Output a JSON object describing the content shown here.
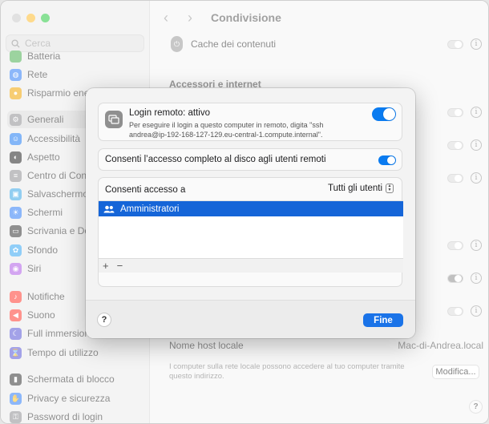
{
  "window": {
    "title": "Condivisione"
  },
  "sidebar": {
    "search_placeholder": "Cerca",
    "items": [
      {
        "label": "Batteria",
        "color": "#4caf50"
      },
      {
        "label": "Rete",
        "color": "#2f7df6"
      },
      {
        "label": "Risparmio energia",
        "color": "#f0a400"
      },
      {
        "label": "Generali",
        "color": "#8e8e93"
      },
      {
        "label": "Accessibilità",
        "color": "#1e7bf2"
      },
      {
        "label": "Aspetto",
        "color": "#222222"
      },
      {
        "label": "Centro di Controllo",
        "color": "#8e8e93"
      },
      {
        "label": "Salvaschermo",
        "color": "#3aa7e6"
      },
      {
        "label": "Schermi",
        "color": "#2f7df6"
      },
      {
        "label": "Scrivania e Dock",
        "color": "#333333"
      },
      {
        "label": "Sfondo",
        "color": "#35a7f2"
      },
      {
        "label": "Siri",
        "color": "#b05be6"
      },
      {
        "label": "Notifiche",
        "color": "#ff3b30"
      },
      {
        "label": "Suono",
        "color": "#ff3b30"
      },
      {
        "label": "Full immersion",
        "color": "#5856d6"
      },
      {
        "label": "Tempo di utilizzo",
        "color": "#5856d6"
      },
      {
        "label": "Schermata di blocco",
        "color": "#333333"
      },
      {
        "label": "Privacy e sicurezza",
        "color": "#2f7df6"
      },
      {
        "label": "Password di login",
        "color": "#8e8e93"
      }
    ]
  },
  "main": {
    "cache_label": "Cache dei contenuti",
    "section_label": "Accessori e internet",
    "hostname_label": "Nome host locale",
    "hostname_value": "Mac-di-Andrea.local",
    "hostname_desc": "I computer sulla rete locale possono accedere al tuo computer tramite questo indirizzo.",
    "edit_button": "Modifica...",
    "help_label": "?"
  },
  "sheet": {
    "login_title": "Login remoto: attivo",
    "login_desc": "Per eseguire il login a questo computer in remoto, digita \"ssh andrea@ip-192-168-127-129.eu-central-1.compute.internal\".",
    "login_enabled": true,
    "disk_label": "Consenti l’accesso completo al disco agli utenti remoti",
    "disk_enabled": true,
    "access_label": "Consenti accesso a",
    "access_value": "Tutti gli utenti",
    "list_items": [
      "Amministratori"
    ],
    "add_label": "+",
    "remove_label": "−",
    "help_label": "?",
    "done_label": "Fine"
  }
}
